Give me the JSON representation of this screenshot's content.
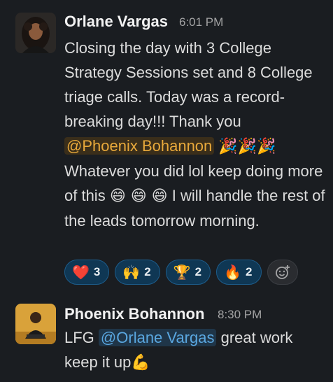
{
  "messages": [
    {
      "author": "Orlane Vargas",
      "time": "6:01 PM",
      "text_1": "Closing the day with 3 College Strategy Sessions set and 8 College triage calls. Today was a record-breaking day!!! Thank you",
      "mention": "@Phoenix Bohannon",
      "emoji_after_mention": "🎉🎉🎉",
      "text_2a": "Whatever you did lol keep doing more of this",
      "emoji_mid": "😄 😄 😄",
      "text_2b": "I will handle the rest of the leads tomorrow morning.",
      "reactions": [
        {
          "emoji": "❤️",
          "count": "3",
          "icon": "heart-icon"
        },
        {
          "emoji": "🙌",
          "count": "2",
          "icon": "raised-hands-icon"
        },
        {
          "emoji": "🏆",
          "count": "2",
          "icon": "trophy-icon"
        },
        {
          "emoji": "🔥",
          "count": "2",
          "icon": "fire-icon"
        }
      ]
    },
    {
      "author": "Phoenix Bohannon",
      "time": "8:30 PM",
      "text_1": "LFG",
      "mention": "@Orlane Vargas",
      "text_2": "great work keep it up",
      "emoji_end": "💪"
    }
  ],
  "colors": {
    "background": "#1a1d21",
    "mention_gold": "#e8a93b",
    "mention_blue": "#5aa7e0",
    "reaction_bg": "#0f3754"
  }
}
